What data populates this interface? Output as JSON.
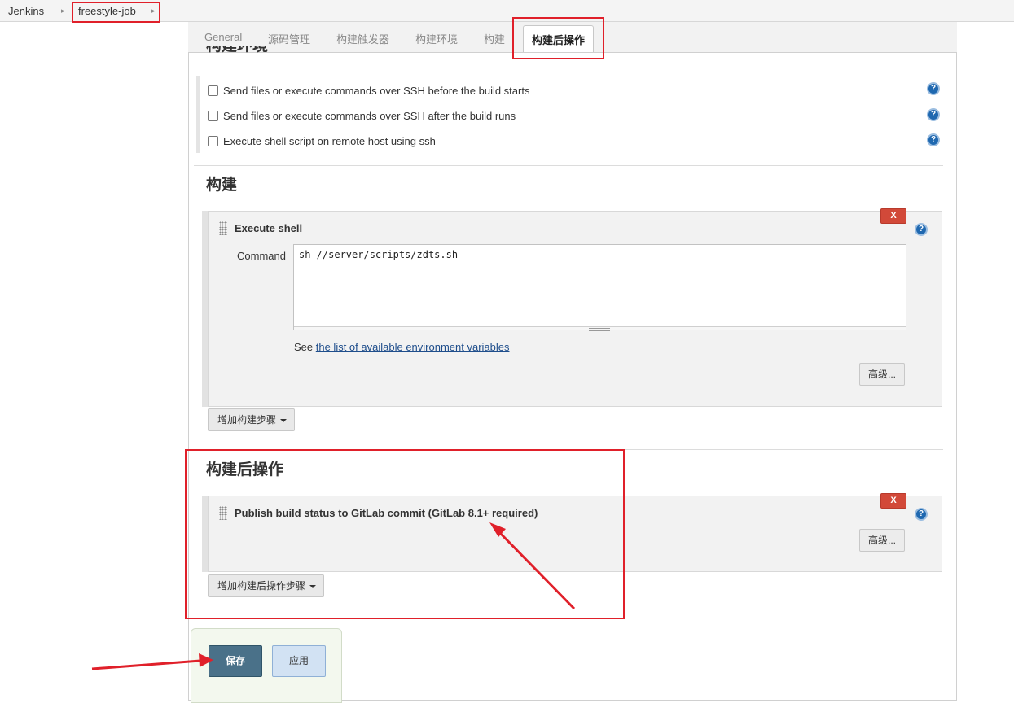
{
  "breadcrumb": {
    "items": [
      "Jenkins",
      "freestyle-job"
    ],
    "separator": "▸"
  },
  "tabs": [
    "General",
    "源码管理",
    "构建触发器",
    "构建环境",
    "构建",
    "构建后操作"
  ],
  "active_tab": "构建后操作",
  "build_environment": {
    "title": "构建环境",
    "options": [
      {
        "label": "Send files or execute commands over SSH before the build starts",
        "checked": false
      },
      {
        "label": "Send files or execute commands over SSH after the build runs",
        "checked": false
      },
      {
        "label": "Execute shell script on remote host using ssh",
        "checked": false
      }
    ]
  },
  "build": {
    "title": "构建",
    "step_title": "Execute shell",
    "command_label": "Command",
    "command_value": "sh //server/scripts/zdts.sh",
    "see_prefix": "See ",
    "see_link": "the list of available environment variables",
    "advanced_label": "高级...",
    "add_step_label": "增加构建步骤"
  },
  "post_build": {
    "title": "构建后操作",
    "step_title": "Publish build status to GitLab commit (GitLab 8.1+ required)",
    "advanced_label": "高级...",
    "add_step_label": "增加构建后操作步骤"
  },
  "delete_label": "X",
  "help_label": "?",
  "actions": {
    "save": "保存",
    "apply": "应用"
  },
  "colors": {
    "annotation": "#e0202a",
    "save_button": "#4a7189",
    "apply_button": "#d2e2f3",
    "delete_button": "#d24939",
    "help_icon": "#1f68b0"
  },
  "icons": [
    "help-icon",
    "drag-handle-icon",
    "caret-down-icon",
    "breadcrumb-separator-icon"
  ]
}
